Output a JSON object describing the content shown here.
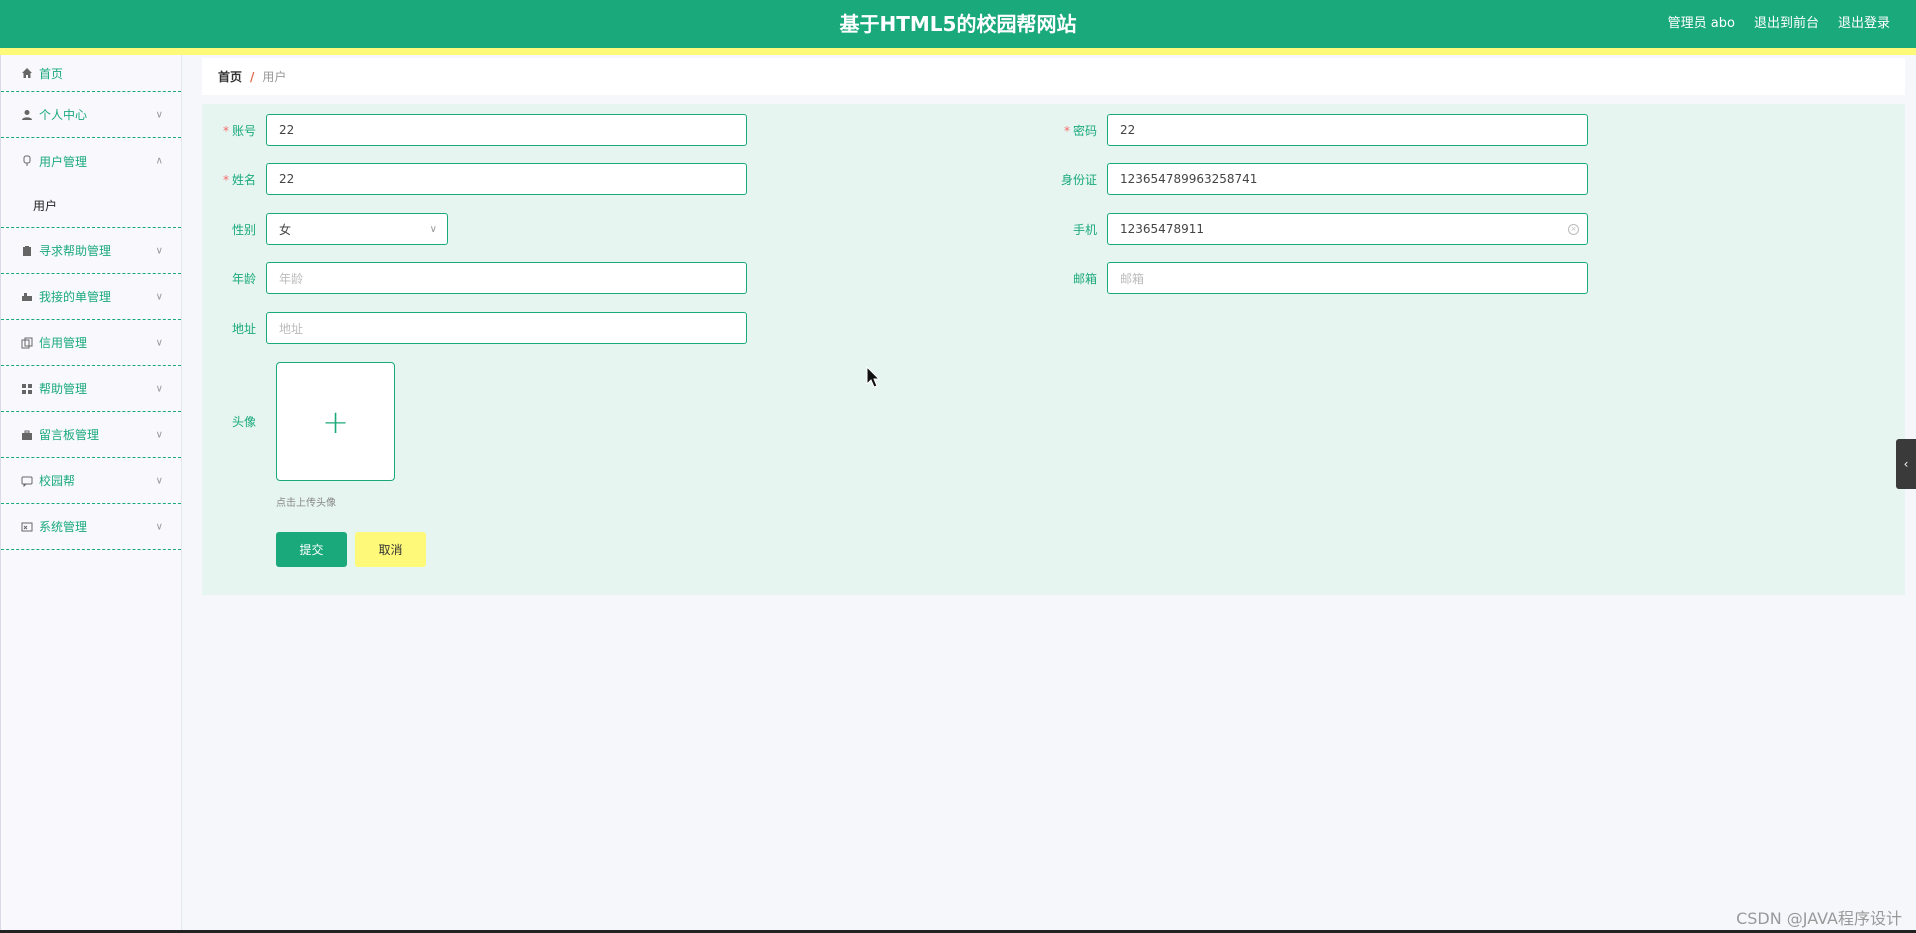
{
  "header": {
    "title": "基于HTML5的校园帮网站",
    "admin_label": "管理员 abo",
    "front_label": "退出到前台",
    "logout_label": "退出登录"
  },
  "sidebar": {
    "home": "首页",
    "items": [
      {
        "label": "个人中心",
        "icon": "person-icon"
      },
      {
        "label": "用户管理",
        "icon": "user-manage-icon",
        "expanded": true,
        "sub": "用户"
      },
      {
        "label": "寻求帮助管理",
        "icon": "clipboard-icon"
      },
      {
        "label": "我接的单管理",
        "icon": "hand-icon"
      },
      {
        "label": "信用管理",
        "icon": "copy-icon"
      },
      {
        "label": "帮助管理",
        "icon": "grid-icon"
      },
      {
        "label": "留言板管理",
        "icon": "briefcase-icon"
      },
      {
        "label": "校园帮",
        "icon": "chat-icon"
      },
      {
        "label": "系统管理",
        "icon": "system-icon"
      }
    ]
  },
  "breadcrumb": {
    "home": "首页",
    "separator": "/",
    "current": "用户"
  },
  "form": {
    "account": {
      "label": "账号",
      "value": "22"
    },
    "password": {
      "label": "密码",
      "value": "22"
    },
    "name": {
      "label": "姓名",
      "value": "22"
    },
    "id_card": {
      "label": "身份证",
      "value": "123654789963258741"
    },
    "gender": {
      "label": "性别",
      "value": "女"
    },
    "phone": {
      "label": "手机",
      "value": "12365478911"
    },
    "age": {
      "label": "年龄",
      "placeholder": "年龄"
    },
    "email": {
      "label": "邮箱",
      "placeholder": "邮箱"
    },
    "address": {
      "label": "地址",
      "placeholder": "地址"
    },
    "avatar": {
      "label": "头像",
      "tip": "点击上传头像"
    },
    "submit_label": "提交",
    "cancel_label": "取消"
  },
  "watermark": "CSDN @JAVA程序设计",
  "colors": {
    "primary": "#1aa97b",
    "accent_yellow": "#fff97a",
    "panel_bg": "#e6f5f0"
  }
}
